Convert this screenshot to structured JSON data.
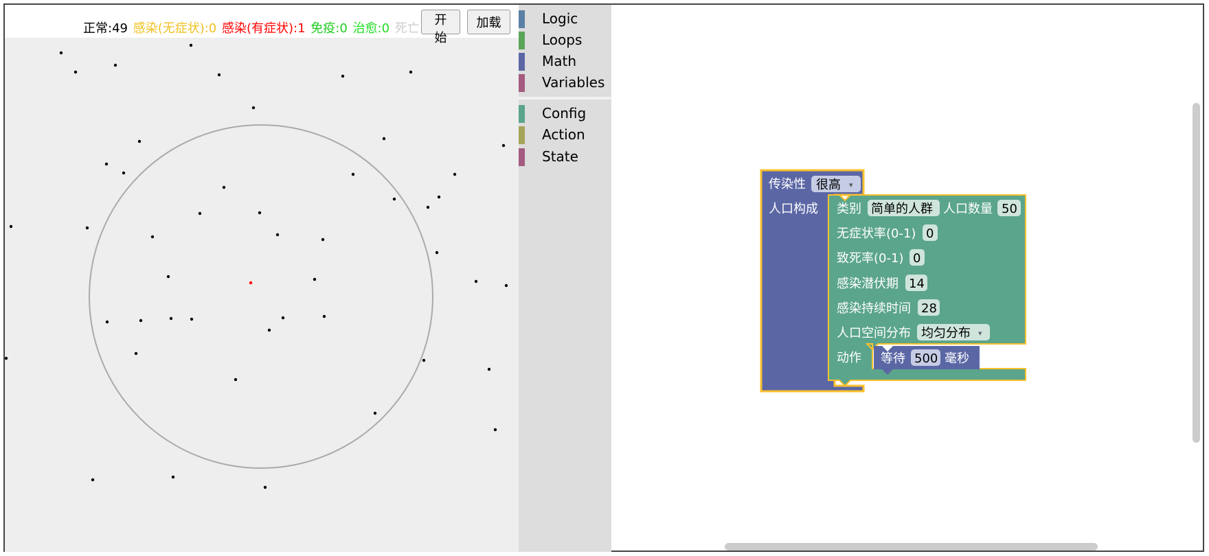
{
  "status": {
    "normal": "正常:49",
    "infected_asymptomatic": "感染(无症状):0",
    "infected_symptomatic": "感染(有症状):1",
    "immune": "免疫:0",
    "cured": "治愈:0",
    "dead": "死亡:0"
  },
  "buttons": {
    "start": "开始",
    "load": "加载"
  },
  "colors": {
    "normal": "#000000",
    "infected_asymptomatic": "#f0c020",
    "infected_symptomatic": "#ff0000",
    "immune": "#22cc22",
    "cured": "#22dd22",
    "dead": "#cccccc",
    "block_purple": "#5b67a5",
    "block_green": "#5ba58c",
    "highlight": "#fbc02d"
  },
  "toolbox": {
    "groups": [
      [
        {
          "label": "Logic",
          "color": "#5b80a5"
        },
        {
          "label": "Loops",
          "color": "#5ba55b"
        },
        {
          "label": "Math",
          "color": "#5b67a5"
        },
        {
          "label": "Variables",
          "color": "#a55b80"
        }
      ],
      [
        {
          "label": "Config",
          "color": "#5ba58c"
        },
        {
          "label": "Action",
          "color": "#a5a55b"
        },
        {
          "label": "State",
          "color": "#a55b80"
        }
      ]
    ]
  },
  "blocks": {
    "transmissibility_label": "传染性",
    "transmissibility_value": "很高",
    "population_label": "人口构成",
    "category_label": "类别",
    "category_value": "简单的人群",
    "population_count_label": "人口数量",
    "population_count_value": "50",
    "asymptomatic_rate_label": "无症状率(0-1)",
    "asymptomatic_rate_value": "0",
    "mortality_rate_label": "致死率(0-1)",
    "mortality_rate_value": "0",
    "incubation_label": "感染潜伏期",
    "incubation_value": "14",
    "duration_label": "感染持续时间",
    "duration_value": "28",
    "distribution_label": "人口空间分布",
    "distribution_value": "均匀分布",
    "action_label": "动作",
    "wait_label": "等待",
    "wait_value": "500",
    "wait_unit": "毫秒"
  }
}
